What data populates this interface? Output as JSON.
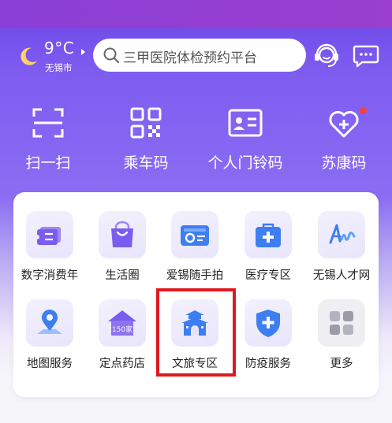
{
  "header": {
    "temperature": "9°C",
    "city": "无锡市",
    "weather_icon": "moon-icon",
    "search_placeholder": "三甲医院体检预约平台",
    "customer_service_icon": "headset-icon",
    "message_icon": "chat-icon"
  },
  "quick_actions": [
    {
      "label": "扫一扫",
      "icon": "scan-icon"
    },
    {
      "label": "乘车码",
      "icon": "qrcode-icon"
    },
    {
      "label": "个人门铃码",
      "icon": "id-card-icon"
    },
    {
      "label": "苏康码",
      "icon": "heart-plus-icon"
    }
  ],
  "services": [
    {
      "label": "数字消费年",
      "icon": "ticket-icon"
    },
    {
      "label": "生活圈",
      "icon": "shopping-bag-icon"
    },
    {
      "label": "爱锡随手拍",
      "icon": "camera-card-icon"
    },
    {
      "label": "医疗专区",
      "icon": "medical-kit-icon"
    },
    {
      "label": "无锡人才网",
      "icon": "talent-logo-icon"
    },
    {
      "label": "地图服务",
      "icon": "map-pin-icon"
    },
    {
      "label": "定点药店",
      "icon": "pharmacy-house-icon",
      "badge": "150家"
    },
    {
      "label": "文旅专区",
      "icon": "gate-tower-icon"
    },
    {
      "label": "防疫服务",
      "icon": "shield-plus-icon"
    },
    {
      "label": "更多",
      "icon": "grid-more-icon"
    }
  ],
  "colors": {
    "header_purple": "#7e5cf0",
    "status_purple": "#8a3fd6",
    "icon_purple": "#7b5cf0",
    "icon_blue": "#3d7ef0",
    "highlight_red": "#e0191e",
    "notification_red": "#f4423c"
  }
}
